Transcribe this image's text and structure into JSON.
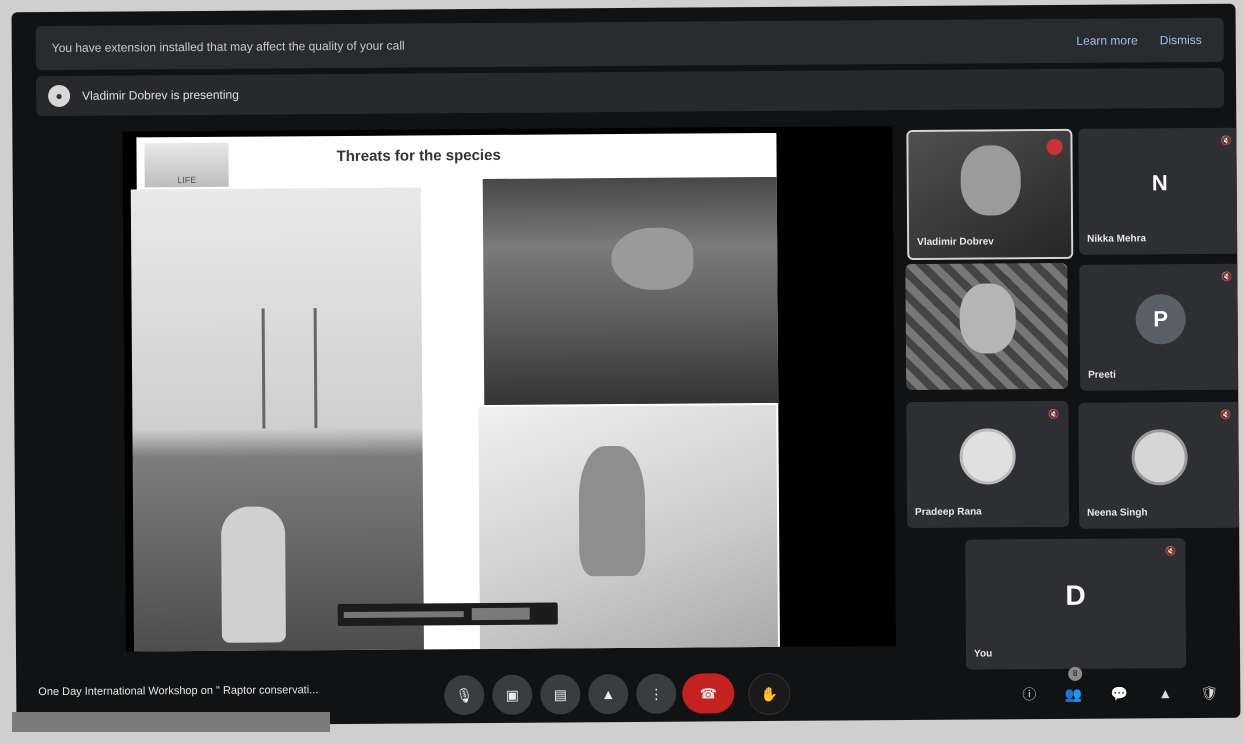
{
  "banner": {
    "message": "You have extension installed that may affect the quality of your call",
    "learn_more": "Learn more",
    "dismiss": "Dismiss"
  },
  "presenting": {
    "text": "Vladimir Dobrev is presenting"
  },
  "slide": {
    "title": "Threats for the species",
    "logo_text": "LIFE"
  },
  "participants": [
    {
      "name": "Vladimir Dobrev",
      "type": "video"
    },
    {
      "name": "Nikka Mehra",
      "initial": "N",
      "avatar_color": "#2e2f33"
    },
    {
      "name": "",
      "type": "video"
    },
    {
      "name": "Preeti",
      "initial": "P",
      "avatar_color": "#5a5f66"
    },
    {
      "name": "Pradeep Rana",
      "type": "photo"
    },
    {
      "name": "Neena Singh",
      "type": "photo"
    },
    {
      "name": "You",
      "initial": "D",
      "avatar_color": "#2e2f33"
    }
  ],
  "bottombar": {
    "meeting_title": "One Day International Workshop on \" Raptor conservati...",
    "participant_count": "8"
  },
  "icons": {
    "mic": "mic-icon",
    "camera": "camera-icon",
    "captions": "captions-icon",
    "present": "present-icon",
    "more": "more-icon",
    "hangup": "hangup-icon",
    "info": "info-icon",
    "people": "people-icon",
    "chat": "chat-icon",
    "activities": "activities-icon",
    "host_controls": "host-controls-icon"
  }
}
